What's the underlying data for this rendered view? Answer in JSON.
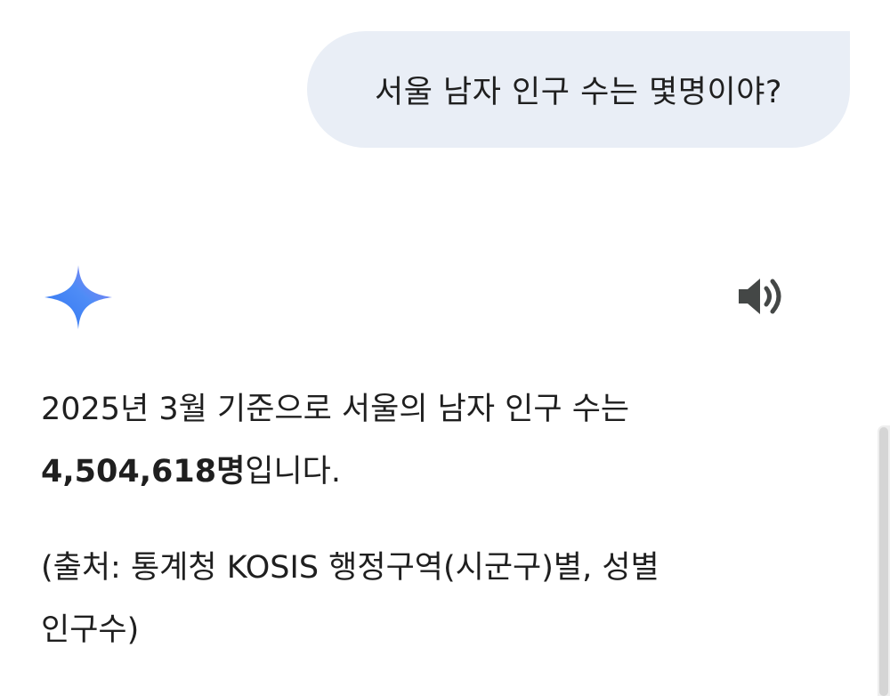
{
  "user_message": {
    "text": "서울 남자 인구 수는 몇명이야?"
  },
  "response": {
    "line1": "2025년 3월 기준으로 서울의 남자 인구 수는",
    "count_bold": "4,504,618명",
    "count_suffix": "입니다.",
    "source_line1": "(출처: 통계청 KOSIS 행정구역(시군구)별, 성별",
    "source_line2": "인구수)"
  },
  "icons": {
    "assistant": "gemini-spark-icon",
    "read_aloud": "speaker-icon"
  },
  "colors": {
    "bubble_bg": "#e9eef6",
    "text": "#1f1f1f",
    "icon_gray": "#444746",
    "spark_gradient": [
      "#4e8cf6",
      "#8a7ff0"
    ]
  }
}
